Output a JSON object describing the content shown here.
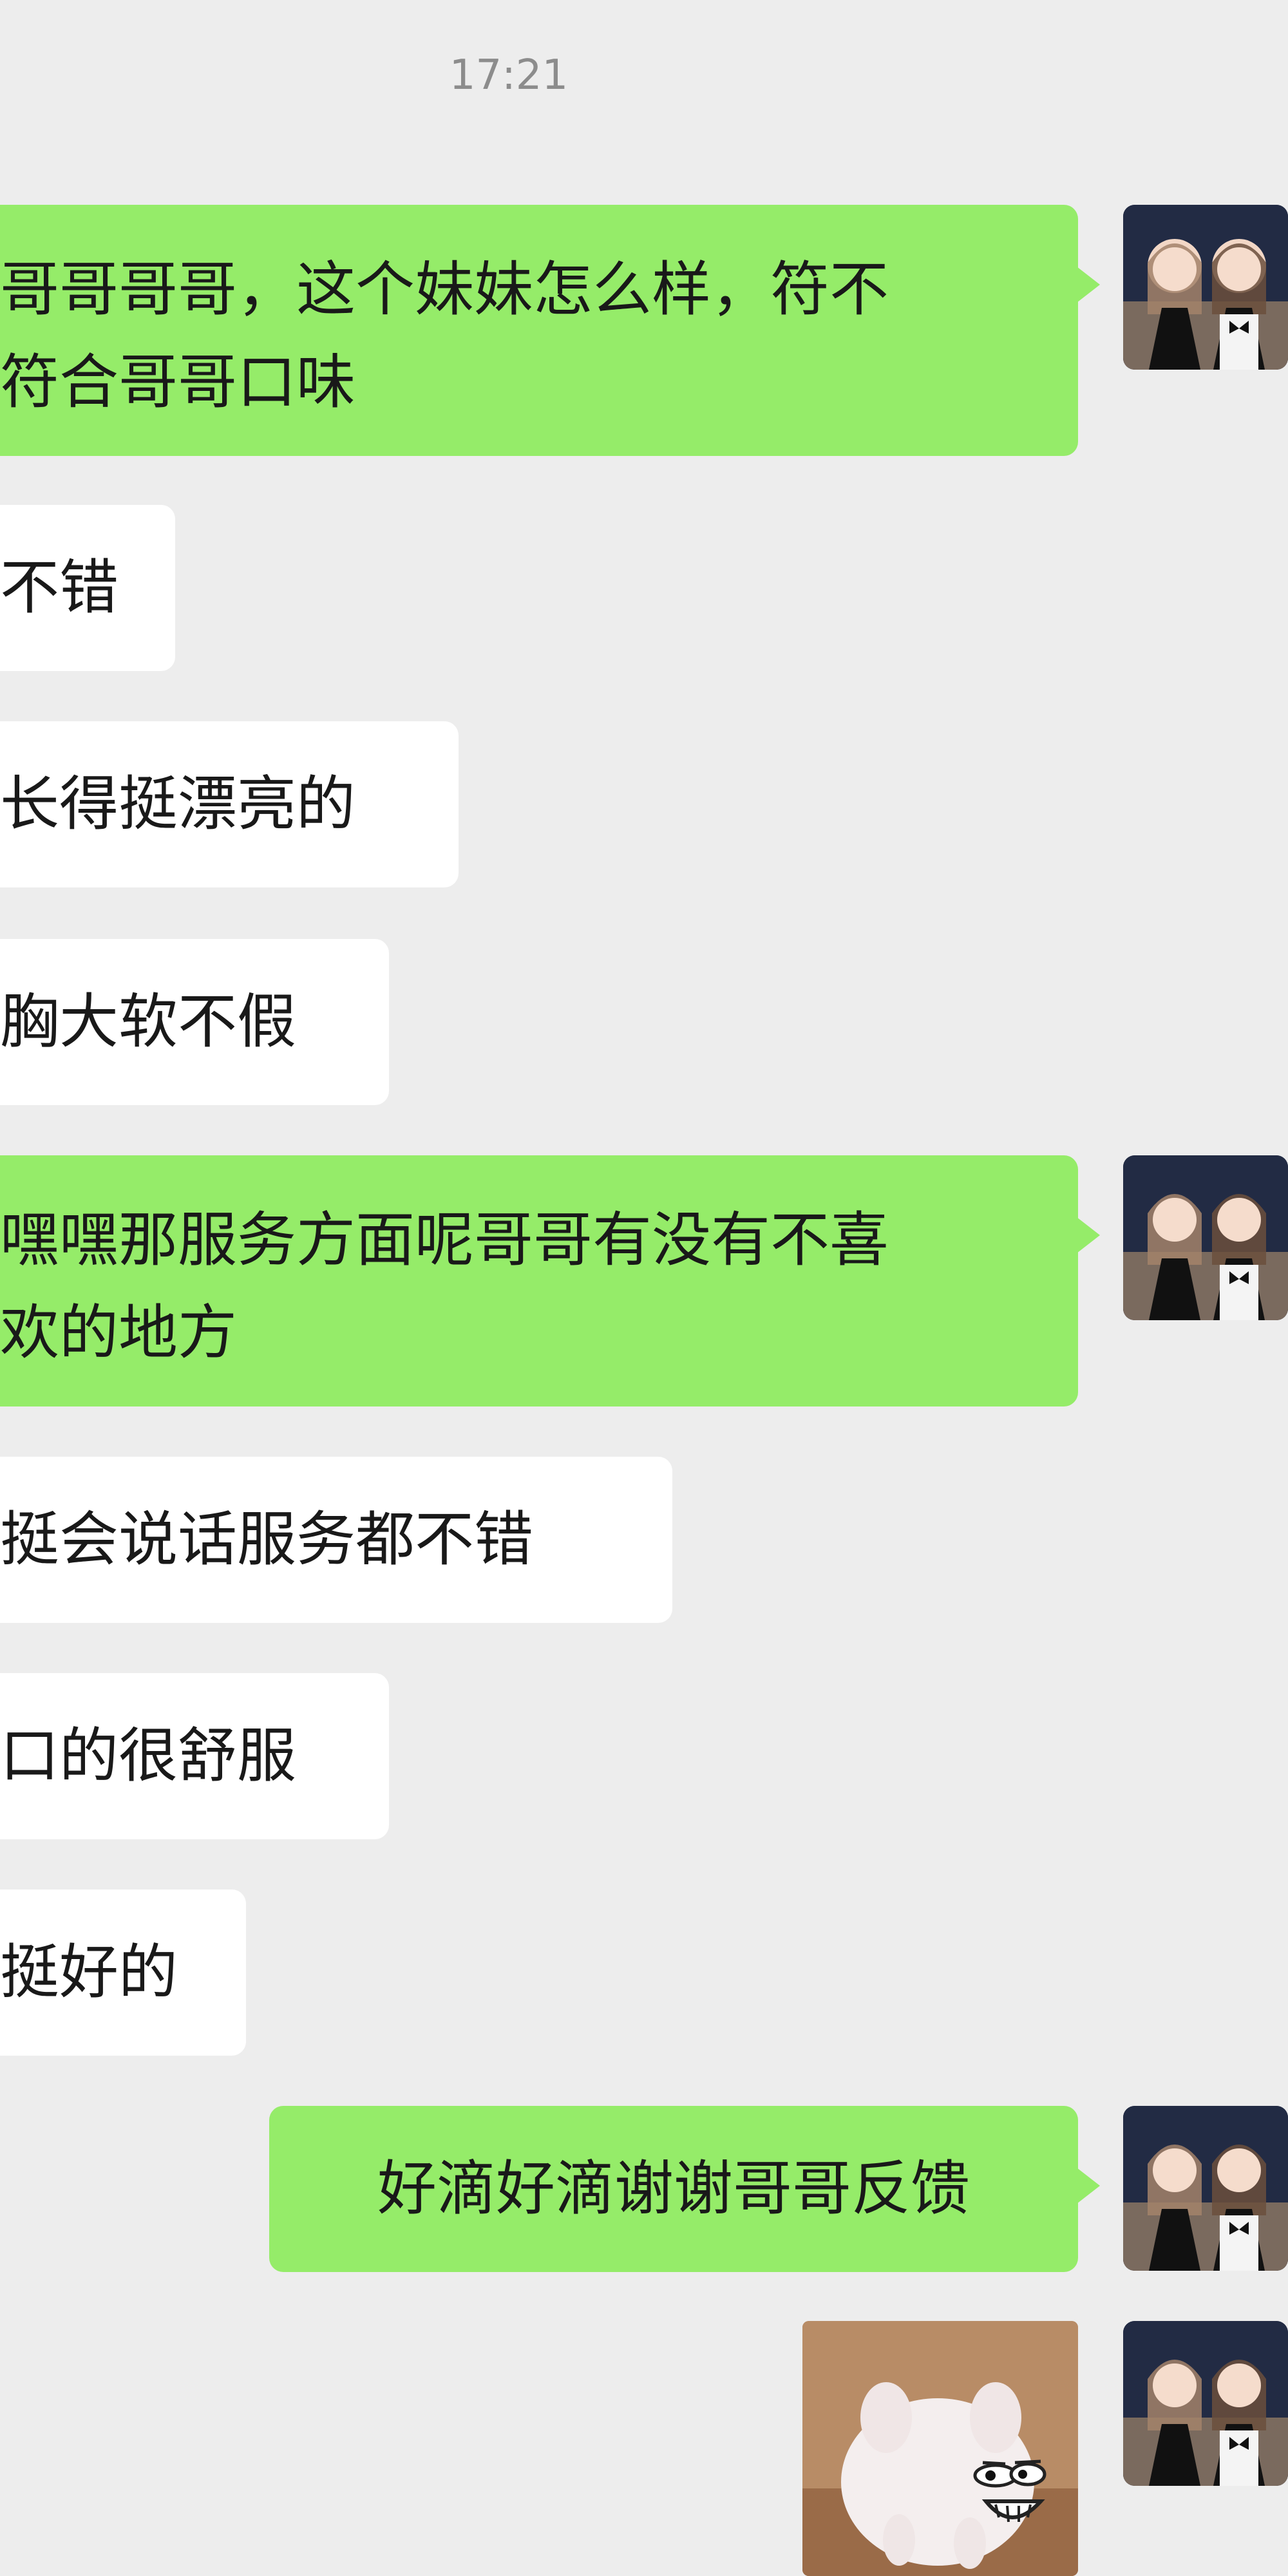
{
  "chat": {
    "timestamp": "17:21",
    "messages": [
      {
        "side": "out",
        "lines": [
          "哥哥哥哥，这个妹妹怎么样，符不",
          "符合哥哥口味"
        ]
      },
      {
        "side": "in",
        "text": "不错"
      },
      {
        "side": "in",
        "text": "长得挺漂亮的"
      },
      {
        "side": "in",
        "text": "胸大软不假"
      },
      {
        "side": "out",
        "lines": [
          "嘿嘿那服务方面呢哥哥有没有不喜",
          "欢的地方"
        ]
      },
      {
        "side": "in",
        "text": "挺会说话服务都不错"
      },
      {
        "side": "in",
        "text": "口的很舒服"
      },
      {
        "side": "in",
        "text": "挺好的"
      },
      {
        "side": "out",
        "lines": [
          "好滴好滴谢谢哥哥反馈"
        ]
      },
      {
        "side": "out",
        "type": "sticker",
        "icon": "pig-face-sticker"
      }
    ]
  },
  "colors": {
    "background": "#ededed",
    "outgoing_bubble": "#95ec69",
    "incoming_bubble": "#ffffff",
    "timestamp_text": "#8c8c8c"
  }
}
